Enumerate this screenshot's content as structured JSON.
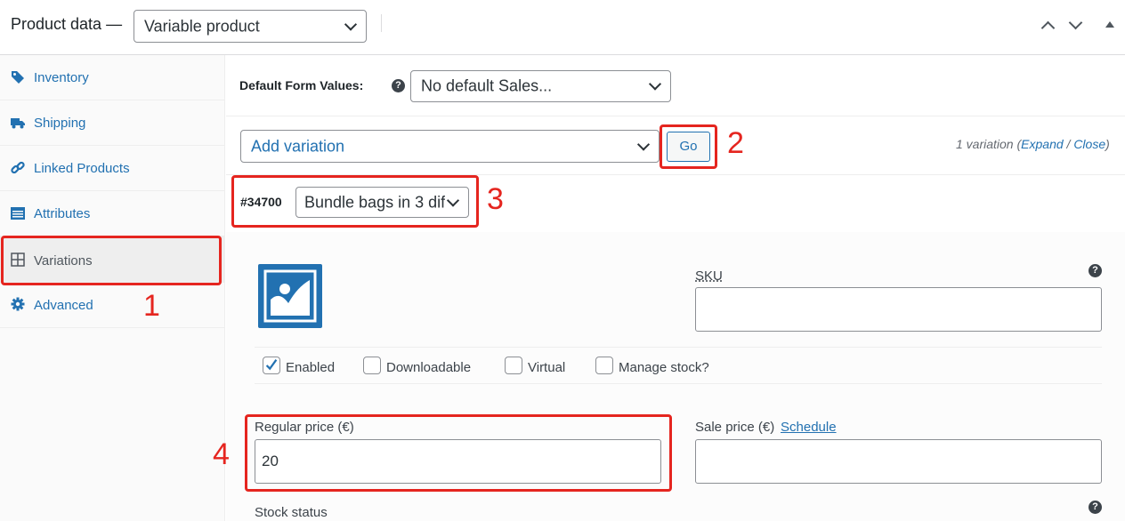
{
  "header": {
    "title": "Product data —",
    "product_type": "Variable product"
  },
  "sidebar": {
    "items": [
      {
        "label": "Inventory",
        "icon": "tag-icon"
      },
      {
        "label": "Shipping",
        "icon": "truck-icon"
      },
      {
        "label": "Linked Products",
        "icon": "link-icon"
      },
      {
        "label": "Attributes",
        "icon": "list-icon"
      },
      {
        "label": "Variations",
        "icon": "grid-icon",
        "active": true
      },
      {
        "label": "Advanced",
        "icon": "gear-icon"
      }
    ]
  },
  "defaults": {
    "label": "Default Form Values:",
    "select_value": "No default Sales..."
  },
  "variations": {
    "action_select": "Add variation",
    "go_label": "Go",
    "count_text": "1 variation (",
    "expand": "Expand",
    "slash": " / ",
    "close": "Close",
    "close_paren": ")",
    "variation_id": "#34700",
    "variation_select": "Bundle bags in 3 dif"
  },
  "variation_panel": {
    "sku_label": "SKU",
    "sku_value": "",
    "checkboxes": [
      {
        "label": "Enabled",
        "checked": true
      },
      {
        "label": "Downloadable",
        "checked": false
      },
      {
        "label": "Virtual",
        "checked": false
      },
      {
        "label": "Manage stock?",
        "checked": false
      }
    ],
    "regular_price_label": "Regular price (€)",
    "regular_price_value": "20",
    "sale_price_label": "Sale price (€)",
    "schedule_link": "Schedule",
    "sale_price_value": "",
    "stock_status_label": "Stock status"
  },
  "annotations": [
    "1",
    "2",
    "3",
    "4"
  ],
  "colors": {
    "link": "#2271b1",
    "annotation": "#e5251f",
    "active_bg": "#eeeeee"
  }
}
